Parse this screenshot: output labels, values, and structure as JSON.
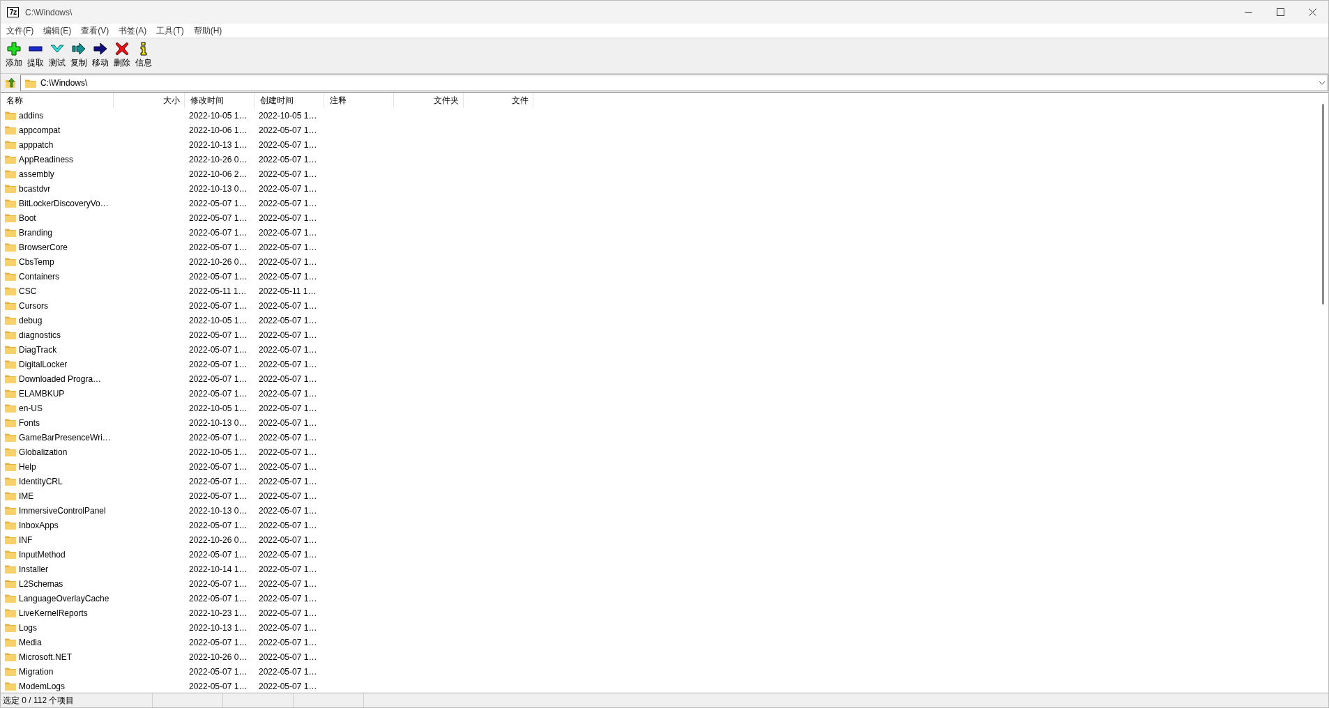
{
  "window": {
    "logo_text": "7z",
    "title": "C:\\Windows\\"
  },
  "menu": [
    "文件(F)",
    "编辑(E)",
    "查看(V)",
    "书签(A)",
    "工具(T)",
    "帮助(H)"
  ],
  "toolbar": [
    {
      "kind": "add",
      "label": "添加"
    },
    {
      "kind": "extract",
      "label": "提取"
    },
    {
      "kind": "test",
      "label": "测试"
    },
    {
      "kind": "copy",
      "label": "复制"
    },
    {
      "kind": "move",
      "label": "移动"
    },
    {
      "kind": "delete",
      "label": "删除"
    },
    {
      "kind": "info",
      "label": "信息"
    }
  ],
  "address": {
    "path": "C:\\Windows\\"
  },
  "table": {
    "columns": [
      "名称",
      "大小",
      "修改时间",
      "创建时间",
      "注释",
      "文件夹",
      "文件"
    ],
    "rows": [
      {
        "name": "addins",
        "modified": "2022-10-05 1…",
        "created": "2022-10-05 1…"
      },
      {
        "name": "appcompat",
        "modified": "2022-10-06 1…",
        "created": "2022-05-07 1…"
      },
      {
        "name": "apppatch",
        "modified": "2022-10-13 1…",
        "created": "2022-05-07 1…"
      },
      {
        "name": "AppReadiness",
        "modified": "2022-10-26 0…",
        "created": "2022-05-07 1…"
      },
      {
        "name": "assembly",
        "modified": "2022-10-06 2…",
        "created": "2022-05-07 1…"
      },
      {
        "name": "bcastdvr",
        "modified": "2022-10-13 0…",
        "created": "2022-05-07 1…"
      },
      {
        "name": "BitLockerDiscoveryVo…",
        "modified": "2022-05-07 1…",
        "created": "2022-05-07 1…"
      },
      {
        "name": "Boot",
        "modified": "2022-05-07 1…",
        "created": "2022-05-07 1…"
      },
      {
        "name": "Branding",
        "modified": "2022-05-07 1…",
        "created": "2022-05-07 1…"
      },
      {
        "name": "BrowserCore",
        "modified": "2022-05-07 1…",
        "created": "2022-05-07 1…"
      },
      {
        "name": "CbsTemp",
        "modified": "2022-10-26 0…",
        "created": "2022-05-07 1…"
      },
      {
        "name": "Containers",
        "modified": "2022-05-07 1…",
        "created": "2022-05-07 1…"
      },
      {
        "name": "CSC",
        "modified": "2022-05-11 1…",
        "created": "2022-05-11 1…"
      },
      {
        "name": "Cursors",
        "modified": "2022-05-07 1…",
        "created": "2022-05-07 1…"
      },
      {
        "name": "debug",
        "modified": "2022-10-05 1…",
        "created": "2022-05-07 1…"
      },
      {
        "name": "diagnostics",
        "modified": "2022-05-07 1…",
        "created": "2022-05-07 1…"
      },
      {
        "name": "DiagTrack",
        "modified": "2022-05-07 1…",
        "created": "2022-05-07 1…"
      },
      {
        "name": "DigitalLocker",
        "modified": "2022-05-07 1…",
        "created": "2022-05-07 1…"
      },
      {
        "name": "Downloaded Progra…",
        "modified": "2022-05-07 1…",
        "created": "2022-05-07 1…"
      },
      {
        "name": "ELAMBKUP",
        "modified": "2022-05-07 1…",
        "created": "2022-05-07 1…"
      },
      {
        "name": "en-US",
        "modified": "2022-10-05 1…",
        "created": "2022-05-07 1…"
      },
      {
        "name": "Fonts",
        "modified": "2022-10-13 0…",
        "created": "2022-05-07 1…"
      },
      {
        "name": "GameBarPresenceWri…",
        "modified": "2022-05-07 1…",
        "created": "2022-05-07 1…"
      },
      {
        "name": "Globalization",
        "modified": "2022-10-05 1…",
        "created": "2022-05-07 1…"
      },
      {
        "name": "Help",
        "modified": "2022-05-07 1…",
        "created": "2022-05-07 1…"
      },
      {
        "name": "IdentityCRL",
        "modified": "2022-05-07 1…",
        "created": "2022-05-07 1…"
      },
      {
        "name": "IME",
        "modified": "2022-05-07 1…",
        "created": "2022-05-07 1…"
      },
      {
        "name": "ImmersiveControlPanel",
        "modified": "2022-10-13 0…",
        "created": "2022-05-07 1…"
      },
      {
        "name": "InboxApps",
        "modified": "2022-05-07 1…",
        "created": "2022-05-07 1…"
      },
      {
        "name": "INF",
        "modified": "2022-10-26 0…",
        "created": "2022-05-07 1…"
      },
      {
        "name": "InputMethod",
        "modified": "2022-05-07 1…",
        "created": "2022-05-07 1…"
      },
      {
        "name": "Installer",
        "modified": "2022-10-14 1…",
        "created": "2022-05-07 1…"
      },
      {
        "name": "L2Schemas",
        "modified": "2022-05-07 1…",
        "created": "2022-05-07 1…"
      },
      {
        "name": "LanguageOverlayCache",
        "modified": "2022-05-07 1…",
        "created": "2022-05-07 1…"
      },
      {
        "name": "LiveKernelReports",
        "modified": "2022-10-23 1…",
        "created": "2022-05-07 1…"
      },
      {
        "name": "Logs",
        "modified": "2022-10-13 1…",
        "created": "2022-05-07 1…"
      },
      {
        "name": "Media",
        "modified": "2022-05-07 1…",
        "created": "2022-05-07 1…"
      },
      {
        "name": "Microsoft.NET",
        "modified": "2022-10-26 0…",
        "created": "2022-05-07 1…"
      },
      {
        "name": "Migration",
        "modified": "2022-05-07 1…",
        "created": "2022-05-07 1…"
      },
      {
        "name": "ModemLogs",
        "modified": "2022-05-07 1…",
        "created": "2022-05-07 1…"
      }
    ]
  },
  "status_bar": {
    "text": "选定 0 / 112 个项目"
  }
}
